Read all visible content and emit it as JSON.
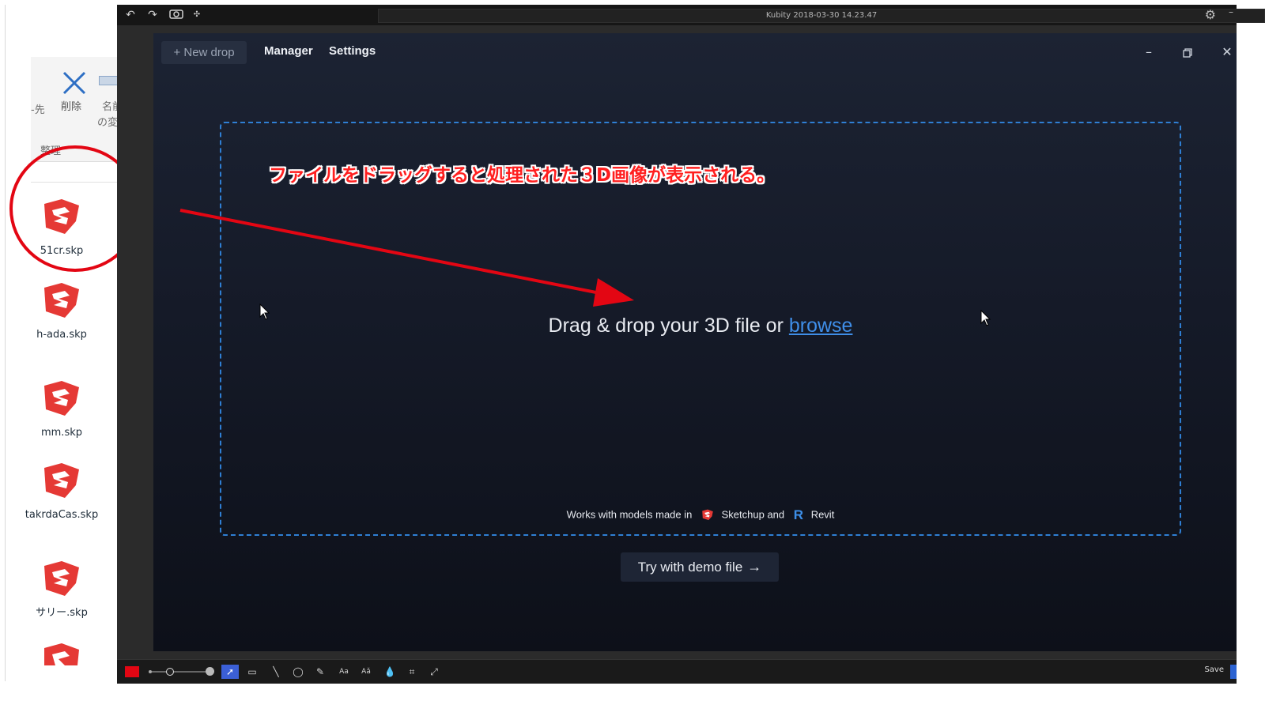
{
  "explorer": {
    "ribbon": {
      "partial_left": "-先",
      "delete_label": "削除",
      "rename_label_1": "名前",
      "rename_label_2": "の変",
      "group_label": "整理"
    },
    "files": [
      {
        "name": "51cr.skp"
      },
      {
        "name": "h-ada.skp"
      },
      {
        "name": "mm.skp"
      },
      {
        "name": "takrdaCas.skp"
      },
      {
        "name": "サリー.skp"
      }
    ]
  },
  "capture_tool": {
    "title": "Kubity 2018-03-30 14.23.47",
    "icons": [
      "undo-icon",
      "redo-icon",
      "camera-icon",
      "gear-icon"
    ],
    "toolbar": {
      "save_label": "Save",
      "selected_color": "#e30613"
    }
  },
  "app": {
    "nav": {
      "new_drop_label": "+ New drop",
      "manager_label": "Manager",
      "settings_label": "Settings"
    },
    "annotation": "ファイルをドラッグすると処理された３D画像が表示される。",
    "drop_zone": {
      "text": "Drag & drop your 3D file or",
      "browse_label": "browse",
      "works_with_text": "Works with models made in",
      "sketchup_label": "Sketchup and",
      "revit_label": "Revit",
      "revit_icon_letter": "R"
    },
    "demo_button_label": "Try with demo file",
    "demo_button_arrow": "→",
    "colors": {
      "accent_blue": "#3f8ee8",
      "annotation_red": "#e30613",
      "background": "#151a28"
    }
  }
}
